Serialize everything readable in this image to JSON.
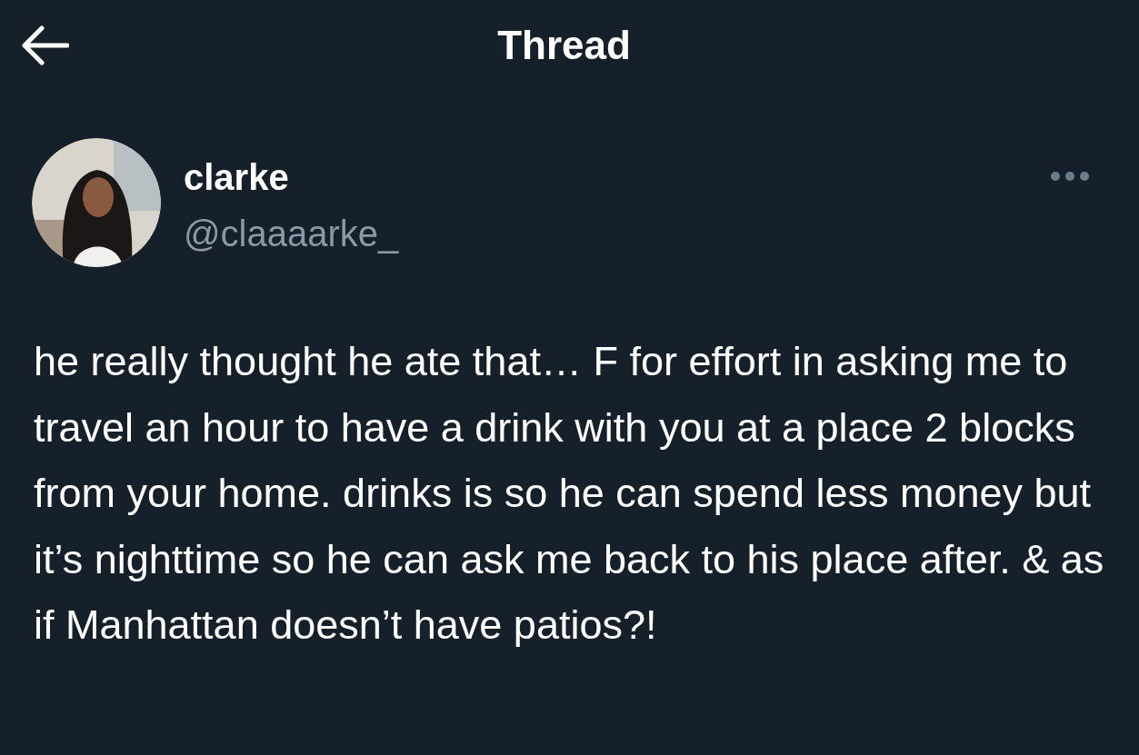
{
  "header": {
    "title": "Thread"
  },
  "tweet": {
    "author": {
      "name": "clarke",
      "handle": "@claaaarke_"
    },
    "text": "he really thought he ate that… F for effort in asking me to travel an hour to have a drink with you at a place 2 blocks from your home. drinks is so he can spend less money but it’s nighttime so he can ask me back to his place after. & as if Manhattan doesn’t have patios?!"
  }
}
